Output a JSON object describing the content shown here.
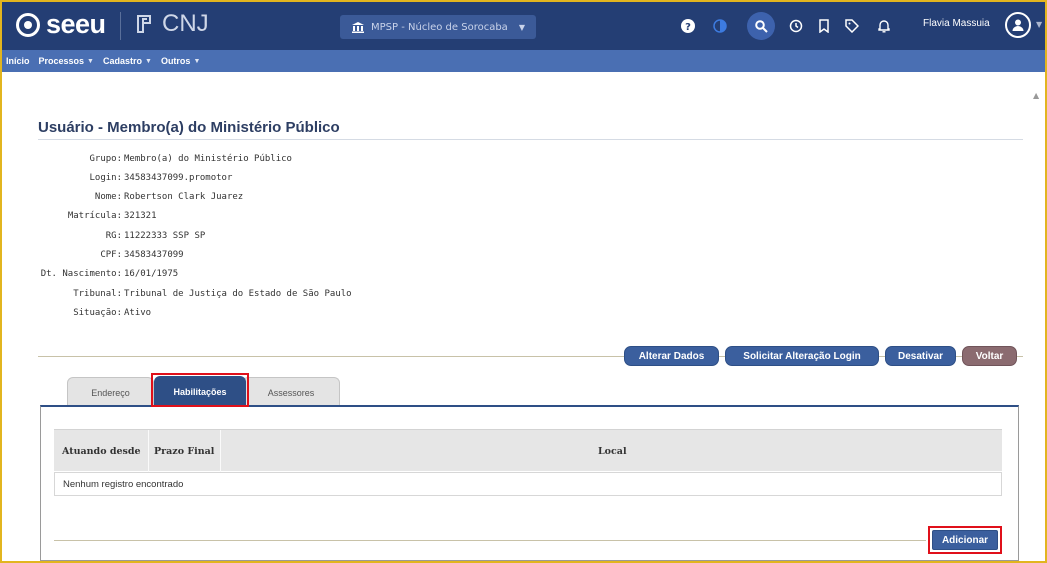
{
  "header": {
    "logo_text": "seeu",
    "cnj_text": "CNJ",
    "unit_selector": "MPSP - Núcleo de Sorocaba",
    "user_name": "Flavia Massuia",
    "icons": [
      "help-icon",
      "contrast-icon",
      "search-icon",
      "history-icon",
      "bookmark-icon",
      "tag-icon",
      "bell-icon",
      "user-avatar-icon"
    ]
  },
  "menu": [
    {
      "label": "Início",
      "has_dropdown": false
    },
    {
      "label": "Processos",
      "has_dropdown": true
    },
    {
      "label": "Cadastro",
      "has_dropdown": true
    },
    {
      "label": "Outros",
      "has_dropdown": true
    }
  ],
  "page": {
    "title": "Usuário - Membro(a) do Ministério Público"
  },
  "info": [
    {
      "label": "Grupo:",
      "value": "Membro(a) do Ministério Público"
    },
    {
      "label": "Login:",
      "value": "34583437099.promotor"
    },
    {
      "label": "Nome:",
      "value": "Robertson Clark Juarez"
    },
    {
      "label": "Matrícula:",
      "value": "321321"
    },
    {
      "label": "RG:",
      "value": "11222333 SSP SP"
    },
    {
      "label": "CPF:",
      "value": "34583437099"
    },
    {
      "label": "Dt. Nascimento:",
      "value": "16/01/1975"
    },
    {
      "label": "Tribunal:",
      "value": "Tribunal de Justiça do Estado de São Paulo"
    },
    {
      "label": "Situação:",
      "value": "Ativo"
    }
  ],
  "actions": {
    "alterar": "Alterar Dados",
    "solicitar": "Solicitar Alteração Login",
    "desativar": "Desativar",
    "voltar": "Voltar"
  },
  "tabs": [
    {
      "label": "Endereço",
      "active": false
    },
    {
      "label": "Habilitações",
      "active": true
    },
    {
      "label": "Assessores",
      "active": false
    }
  ],
  "table": {
    "columns": [
      "Atuando desde",
      "Prazo Final",
      "Local"
    ],
    "empty_message": "Nenhum registro encontrado"
  },
  "add_button": "Adicionar",
  "colors": {
    "topbar": "#243e74",
    "menubar": "#4a6fb3",
    "primary_button": "#3b5f9e",
    "voltar_button": "#8b6b70",
    "highlight": "#e0101a"
  }
}
